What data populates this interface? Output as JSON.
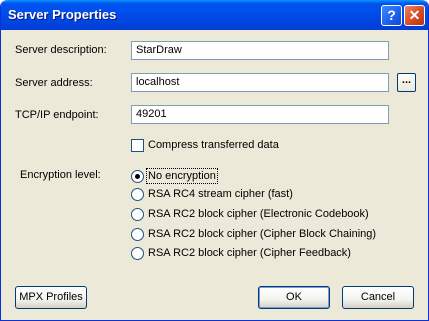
{
  "window": {
    "title": "Server Properties",
    "help_glyph": "?",
    "close_glyph": "✕"
  },
  "fields": {
    "description": {
      "label": "Server description:",
      "value": "StarDraw"
    },
    "address": {
      "label": "Server address:",
      "value": "localhost",
      "browse_label": "..."
    },
    "endpoint": {
      "label": "TCP/IP endpoint:",
      "value": "49201"
    }
  },
  "compress": {
    "label": "Compress transferred data",
    "checked": false
  },
  "encryption": {
    "label": "Encryption level:",
    "selected": 0,
    "options": [
      "No encryption",
      "RSA RC4 stream cipher (fast)",
      "RSA RC2 block cipher (Electronic Codebook)",
      "RSA RC2 block cipher (Cipher Block Chaining)",
      "RSA RC2 block cipher (Cipher Feedback)"
    ]
  },
  "buttons": {
    "mpx_profiles": "MPX Profiles",
    "ok": "OK",
    "cancel": "Cancel"
  }
}
